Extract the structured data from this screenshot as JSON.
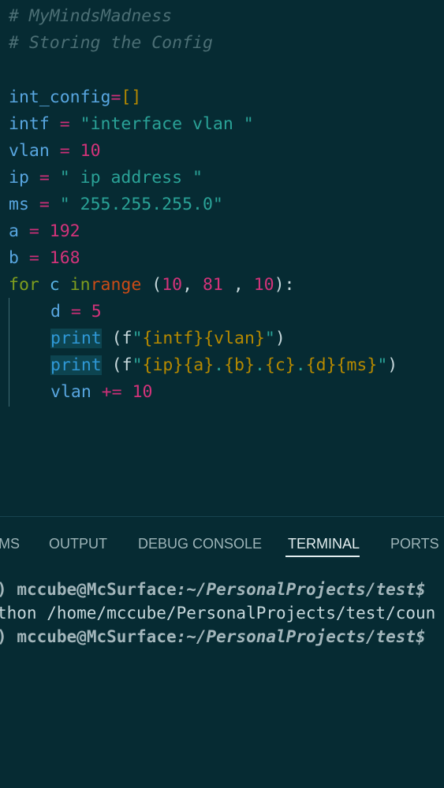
{
  "editor": {
    "comment1": "# MyMindsMadness",
    "comment2": "# Storing the Config",
    "line_int_config": {
      "name": "int_config",
      "op": "=",
      "value": "[]"
    },
    "line_intf": {
      "name": "intf",
      "op": " = ",
      "value": "\"interface vlan \""
    },
    "line_vlan": {
      "name": "vlan",
      "op": " = ",
      "value": "10"
    },
    "line_ip": {
      "name": "ip",
      "op": " = ",
      "value": "\" ip address \""
    },
    "line_ms": {
      "name": "ms",
      "op": " = ",
      "value": "\" 255.255.255.0\""
    },
    "line_a": {
      "name": "a",
      "op": " = ",
      "value": "192"
    },
    "line_b": {
      "name": "b",
      "op": " = ",
      "value": "168"
    },
    "line_for": {
      "kw_for": "for",
      "var_c": " c ",
      "kw_in": "in",
      "fn_range": "range",
      "open": " (",
      "n1": "10",
      "comma1": ", ",
      "n2": "81",
      "comma2": " , ",
      "n3": "10",
      "close": "):"
    },
    "line_d": {
      "name": "d",
      "op": " = ",
      "value": "5"
    },
    "line_print1": {
      "fn": "print",
      "open": " (",
      "prefix": "f",
      "q1": "\"",
      "expr1": "{intf}",
      "expr2": "{vlan}",
      "q2": "\"",
      "close": ")"
    },
    "line_print2": {
      "fn": "print",
      "open": " (",
      "prefix": "f",
      "q1": "\"",
      "expr1": "{ip}",
      "expr2": "{a}",
      "dot1": ".",
      "expr3": "{b}",
      "dot2": ".",
      "expr4": "{c}",
      "dot3": ".",
      "expr5": "{d}",
      "expr6": "{ms}",
      "q2": "\"",
      "close": ")"
    },
    "line_vlan_inc": {
      "name": "vlan",
      "op": " += ",
      "value": "10"
    }
  },
  "panel": {
    "tabs": [
      {
        "label": "MS"
      },
      {
        "label": "OUTPUT"
      },
      {
        "label": "DEBUG CONSOLE"
      },
      {
        "label": "TERMINAL"
      },
      {
        "label": "PORTS"
      }
    ],
    "active_tab": "TERMINAL",
    "terminal": {
      "line1": {
        "marker": ")",
        "user": "mccube@McSurface",
        "path": ":~/PersonalProjects/test$"
      },
      "line2": {
        "text": "thon /home/mccube/PersonalProjects/test/coun"
      },
      "line3": {
        "marker": ")",
        "user": "mccube@McSurface",
        "path": ":~/PersonalProjects/test$"
      }
    }
  }
}
